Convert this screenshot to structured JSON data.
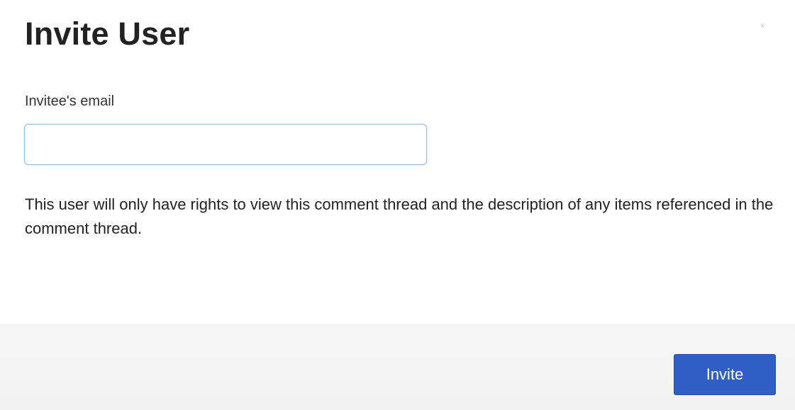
{
  "dialog": {
    "title": "Invite User",
    "close_icon_glyph": "×",
    "email_label": "Invitee's email",
    "email_value": "",
    "info_text": "This user will only have rights to view this comment thread and the description of any items referenced in the comment thread.",
    "invite_label": "Invite"
  },
  "colors": {
    "primary_button": "#2f5fc4",
    "input_focus_border": "#8fbce8",
    "footer_background": "#f4f4f4"
  },
  "icons": {
    "close": "close-icon"
  }
}
